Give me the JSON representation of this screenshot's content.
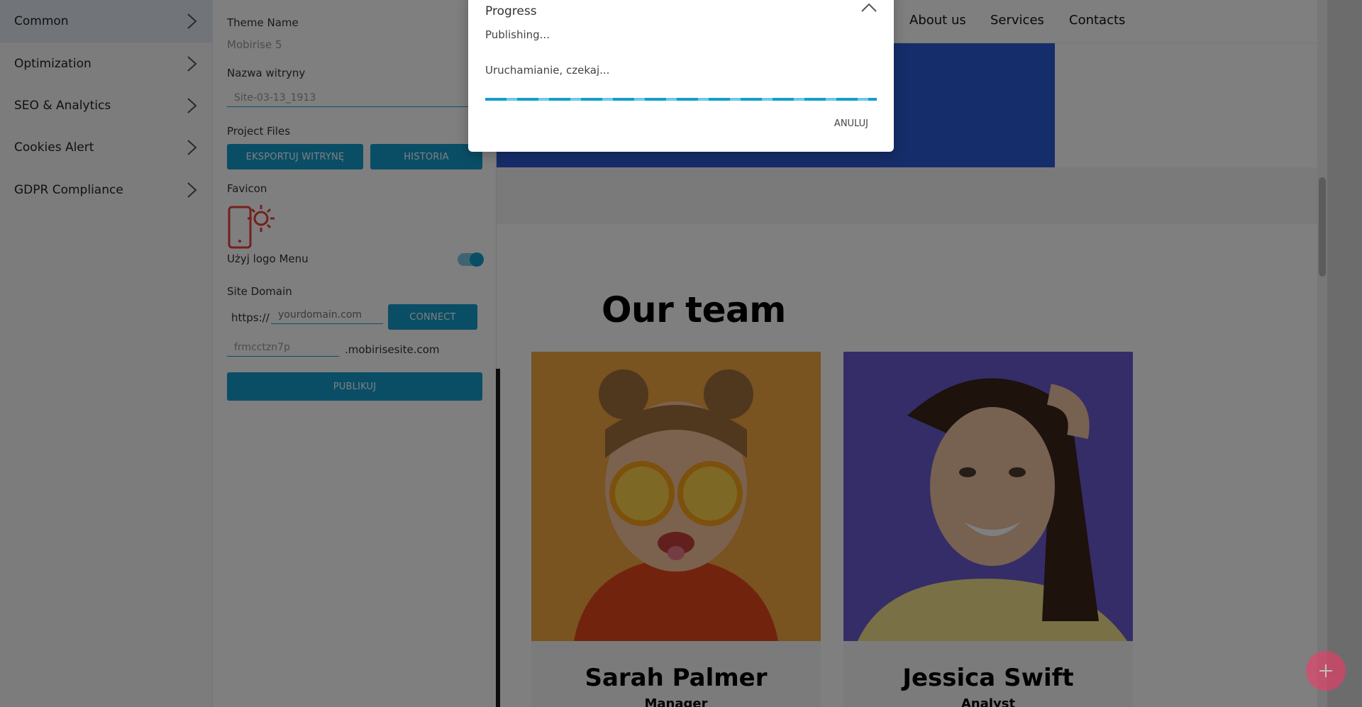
{
  "sidebar": {
    "items": [
      {
        "label": "Common",
        "active": true
      },
      {
        "label": "Optimization"
      },
      {
        "label": "SEO & Analytics"
      },
      {
        "label": "Cookies Alert"
      },
      {
        "label": "GDPR Compliance"
      }
    ]
  },
  "panel": {
    "theme_name_label": "Theme Name",
    "theme_name_value": "Mobirise 5",
    "site_name_label": "Nazwa witryny",
    "site_name_value": "Site-03-13_1913",
    "project_files_label": "Project Files",
    "export_button": "EKSPORTUJ WITRYNĘ",
    "history_button": "HISTORIA",
    "favicon_label": "Favicon",
    "use_logo_menu_label": "Użyj logo Menu",
    "use_logo_menu_on": true,
    "site_domain_label": "Site Domain",
    "protocol_prefix": "https://",
    "domain_placeholder": "yourdomain.com",
    "connect_button": "CONNECT",
    "subdomain_value": "frmcctzn7p",
    "subdomain_suffix": ".mobirisesite.com",
    "publish_button": "PUBLIKUJ"
  },
  "canvas": {
    "nav": [
      "About us",
      "Services",
      "Contacts"
    ],
    "team_title": "Our team",
    "members": [
      {
        "name": "Sarah Palmer",
        "role": "Manager"
      },
      {
        "name": "Jessica Swift",
        "role": "Analyst"
      }
    ]
  },
  "modal": {
    "title": "Progress",
    "status": "Publishing...",
    "substatus": "Uruchamianie, czekaj...",
    "progress": 1.0,
    "cancel": "ANULUJ"
  },
  "colors": {
    "accent": "#149dcc",
    "hero_blue": "#2c5bd6",
    "fab": "#ff3366",
    "favicon_red": "#e8413a"
  },
  "icons": {
    "fab": "plus-icon",
    "modal_close": "chevron-up-icon",
    "sidebar": "chevron-right-icon",
    "favicon": "phone-sun-icon"
  }
}
